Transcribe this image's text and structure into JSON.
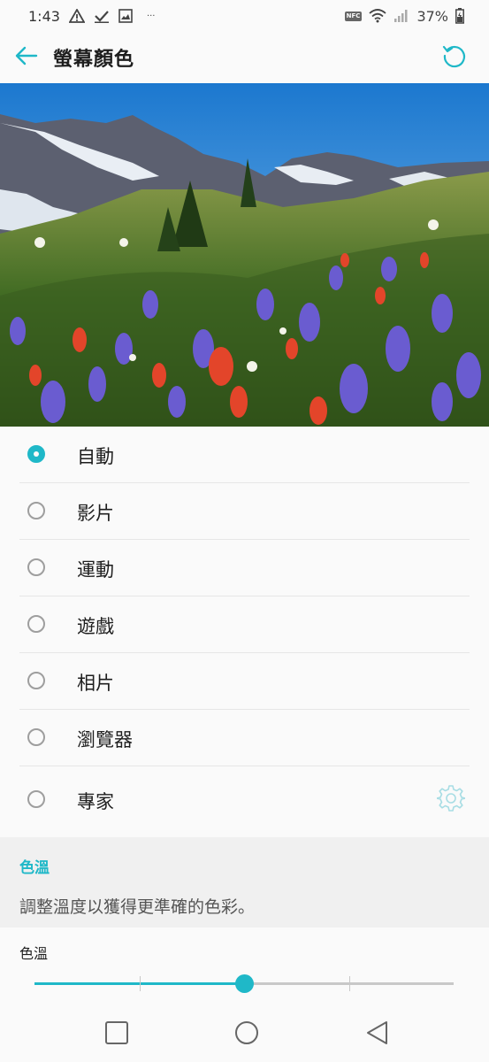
{
  "status_bar": {
    "time": "1:43",
    "more": "···",
    "nfc": "NFC",
    "battery": "37%",
    "icons": [
      "warning-icon",
      "check-icon",
      "image-icon",
      "nfc-icon",
      "wifi-icon",
      "signal-icon",
      "battery-icon"
    ]
  },
  "app_bar": {
    "title": "螢幕顏色",
    "back_icon": "arrow-left-icon",
    "reset_icon": "reset-icon"
  },
  "preview": {
    "image": "mountain-wildflower-meadow"
  },
  "options": [
    {
      "label": "自動",
      "selected": true
    },
    {
      "label": "影片",
      "selected": false
    },
    {
      "label": "運動",
      "selected": false
    },
    {
      "label": "遊戲",
      "selected": false
    },
    {
      "label": "相片",
      "selected": false
    },
    {
      "label": "瀏覽器",
      "selected": false
    },
    {
      "label": "專家",
      "selected": false,
      "settings_icon": "gear-icon"
    }
  ],
  "color_temperature": {
    "section_title": "色溫",
    "description": "調整溫度以獲得更準確的色彩。",
    "slider_label": "色溫",
    "slider_value": 0.5,
    "slider_ticks": 3
  },
  "nav_bar": {
    "icons": [
      "square-icon",
      "circle-icon",
      "triangle-back-icon"
    ]
  },
  "colors": {
    "accent": "#1fb8c8",
    "background": "#fafafa",
    "section_background": "#f0f0f0",
    "divider": "#e6e6e6"
  }
}
